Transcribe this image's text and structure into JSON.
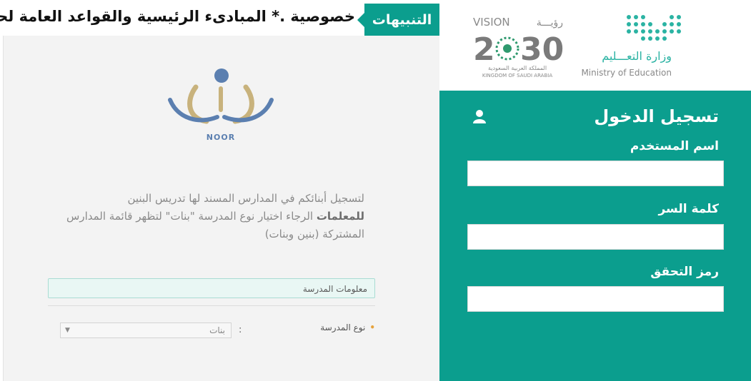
{
  "ticker": {
    "tab_label": "التنبيهات",
    "text": "خصوصية .* المبادىء الرئيسية والقواعد العامة لحماية"
  },
  "brand": {
    "logo_text": "NOOR",
    "vision_label": "VISION",
    "vision_arabic": "رؤيـــة",
    "vision_year_left": "2",
    "vision_year_right": "30",
    "vision_kingdom_ar": "المملكة العربية السعودية",
    "vision_kingdom_en": "KINGDOM OF SAUDI ARABIA",
    "ministry_ar": "وزارة التعـــليم",
    "ministry_en": "Ministry of Education"
  },
  "notice": {
    "line1": "لتسجيل أبنائكم في المدارس المسند لها تدريس البنين",
    "bold_word": "للمعلمات",
    "line2_rest": " الرجاء اختيار نوع المدرسة \"بنات\" لتظهر قائمة المدارس",
    "line3": "المشتركة (بنين وبنات)"
  },
  "school_form": {
    "section_title": "معلومات المدرسة",
    "type_label": "نوع المدرسة",
    "colon": ":",
    "type_value": "بنات"
  },
  "login": {
    "title": "تسجيل الدخول",
    "username_label": "اسم المستخدم",
    "username_value": "",
    "password_label": "كلمة السر",
    "password_value": "",
    "captcha_label": "رمز التحقق",
    "captcha_value": ""
  },
  "colors": {
    "accent": "#0b9e8e",
    "logo_blue": "#5b7fb0",
    "logo_gold": "#c8b27c"
  },
  "icons": {
    "user": "user-icon",
    "dropdown": "chevron-down-icon"
  }
}
